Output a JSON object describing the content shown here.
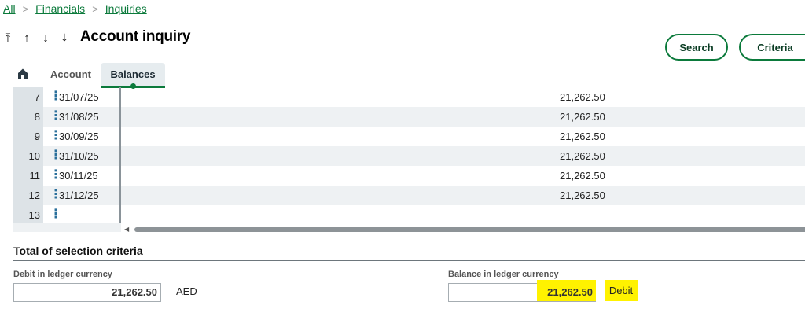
{
  "breadcrumb": {
    "items": [
      "All",
      "Financials",
      "Inquiries"
    ],
    "separator": ">"
  },
  "nav_icons": [
    "first-record-icon",
    "previous-record-icon",
    "next-record-icon",
    "last-record-icon"
  ],
  "page": {
    "title": "Account inquiry"
  },
  "buttons": {
    "search": "Search",
    "criteria": "Criteria"
  },
  "tabs": {
    "home_icon": "home-icon",
    "items": [
      {
        "label": "Account",
        "active": false
      },
      {
        "label": "Balances",
        "active": true
      }
    ]
  },
  "grid": {
    "rows": [
      {
        "num": "7",
        "date": "31/07/25",
        "amount": "21,262.50"
      },
      {
        "num": "8",
        "date": "31/08/25",
        "amount": "21,262.50"
      },
      {
        "num": "9",
        "date": "30/09/25",
        "amount": "21,262.50"
      },
      {
        "num": "10",
        "date": "31/10/25",
        "amount": "21,262.50"
      },
      {
        "num": "11",
        "date": "30/11/25",
        "amount": "21,262.50"
      },
      {
        "num": "12",
        "date": "31/12/25",
        "amount": "21,262.50"
      },
      {
        "num": "13",
        "date": "",
        "amount": ""
      }
    ]
  },
  "totals": {
    "title": "Total of selection criteria",
    "debit_label": "Debit in ledger currency",
    "debit_value": "21,262.50",
    "currency": "AED",
    "balance_label": "Balance in ledger currency",
    "balance_value": "21,262.50",
    "balance_side": "Debit"
  },
  "colors": {
    "accent": "#0b7a3b",
    "highlight": "#fff200"
  }
}
